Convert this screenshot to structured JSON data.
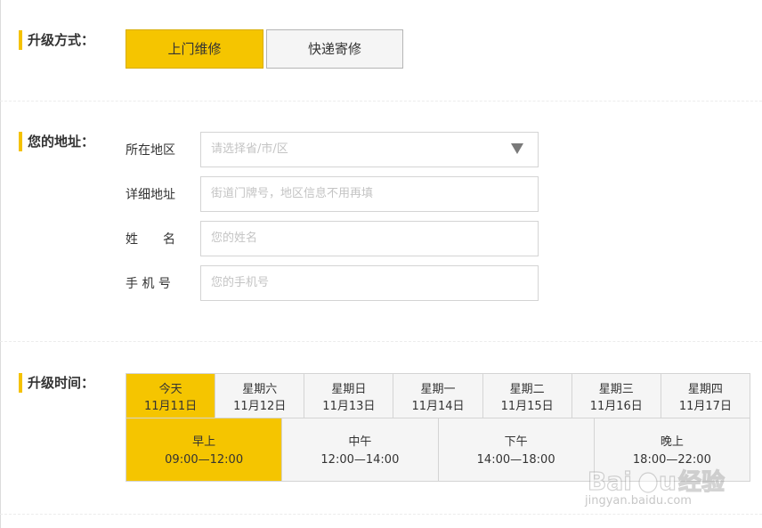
{
  "method": {
    "label": "升级方式：",
    "options": [
      {
        "label": "上门维修",
        "selected": true
      },
      {
        "label": "快递寄修",
        "selected": false
      }
    ]
  },
  "address": {
    "label": "您的地址：",
    "fields": {
      "region": {
        "label": "所在地区",
        "placeholder": "请选择省/市/区"
      },
      "detail": {
        "label": "详细地址",
        "placeholder": "街道门牌号，地区信息不用再填"
      },
      "name": {
        "label": "姓　　名",
        "placeholder": "您的姓名"
      },
      "phone": {
        "label": "手 机 号",
        "placeholder": "您的手机号"
      }
    }
  },
  "time": {
    "label": "升级时间：",
    "dates": [
      {
        "day": "今天",
        "date": "11月11日",
        "selected": true
      },
      {
        "day": "星期六",
        "date": "11月12日",
        "selected": false
      },
      {
        "day": "星期日",
        "date": "11月13日",
        "selected": false
      },
      {
        "day": "星期一",
        "date": "11月14日",
        "selected": false
      },
      {
        "day": "星期二",
        "date": "11月15日",
        "selected": false
      },
      {
        "day": "星期三",
        "date": "11月16日",
        "selected": false
      },
      {
        "day": "星期四",
        "date": "11月17日",
        "selected": false
      }
    ],
    "slots": [
      {
        "name": "早上",
        "range": "09:00—12:00",
        "selected": true
      },
      {
        "name": "中午",
        "range": "12:00—14:00",
        "selected": false
      },
      {
        "name": "下午",
        "range": "14:00—18:00",
        "selected": false
      },
      {
        "name": "晚上",
        "range": "18:00—22:00",
        "selected": false
      }
    ]
  },
  "watermark": {
    "brand": "Baidu经验",
    "url": "jingyan.baidu.com"
  },
  "colors": {
    "accent": "#f5c500",
    "border": "#d4d4d4",
    "inactive_bg": "#f5f5f5"
  }
}
